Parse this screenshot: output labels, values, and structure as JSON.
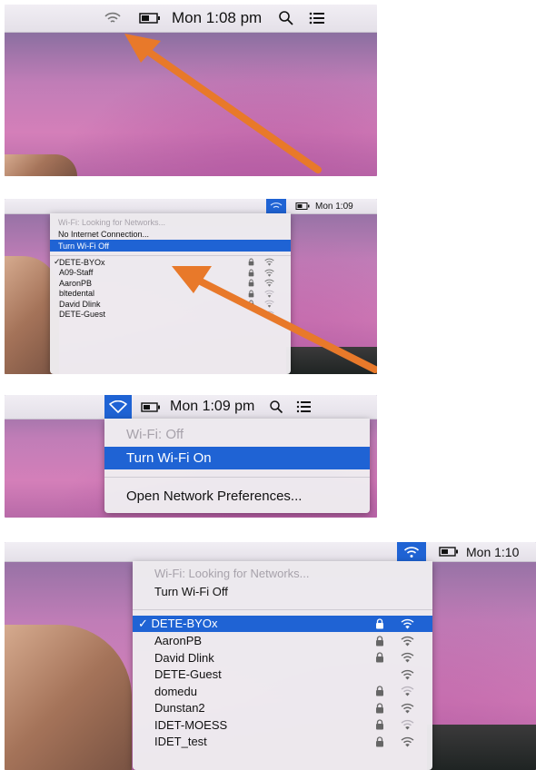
{
  "panel1": {
    "clock": "Mon 1:08 pm",
    "icons": [
      "wifi-searching-icon",
      "battery-icon",
      "search-icon",
      "list-icon"
    ]
  },
  "panel2": {
    "clock": "Mon 1:09",
    "status": "Wi-Fi: Looking for Networks...",
    "no_internet": "No Internet Connection...",
    "turn_off": "Turn Wi-Fi Off",
    "networks": [
      {
        "name": "DETE-BYOx",
        "checked": true,
        "locked": true
      },
      {
        "name": "A09-Staff",
        "checked": false,
        "locked": true
      },
      {
        "name": "AaronPB",
        "checked": false,
        "locked": true
      },
      {
        "name": "bltedental",
        "checked": false,
        "locked": true
      },
      {
        "name": "David Dlink",
        "checked": false,
        "locked": true
      },
      {
        "name": "DETE-Guest",
        "checked": false,
        "locked": false
      }
    ]
  },
  "panel3": {
    "clock": "Mon 1:09 pm",
    "status": "Wi-Fi: Off",
    "turn_on": "Turn Wi-Fi On",
    "prefs": "Open Network Preferences..."
  },
  "panel4": {
    "clock": "Mon 1:10",
    "status": "Wi-Fi: Looking for Networks...",
    "turn_off": "Turn Wi-Fi Off",
    "networks": [
      {
        "name": "✓ DETE-BYOx",
        "locked": true,
        "selected": true
      },
      {
        "name": "AaronPB",
        "locked": true,
        "selected": false
      },
      {
        "name": "David Dlink",
        "locked": true,
        "selected": false
      },
      {
        "name": "DETE-Guest",
        "locked": false,
        "selected": false
      },
      {
        "name": "domedu",
        "locked": true,
        "selected": false
      },
      {
        "name": "Dunstan2",
        "locked": true,
        "selected": false
      },
      {
        "name": "IDET-MOESS",
        "locked": true,
        "selected": false
      },
      {
        "name": "IDET_test",
        "locked": true,
        "selected": false
      }
    ]
  },
  "colors": {
    "highlight": "#1f63d4",
    "arrow": "#e8792a",
    "menubar": "#ece8ef"
  }
}
